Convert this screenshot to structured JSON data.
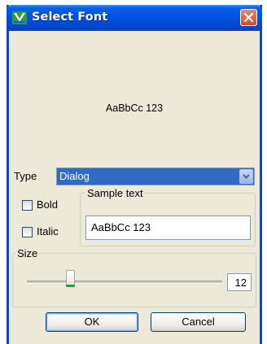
{
  "window": {
    "title": "Select Font"
  },
  "preview": {
    "text": "AaBbCc 123"
  },
  "type": {
    "label": "Type",
    "value": "Dialog"
  },
  "style": {
    "bold_label": "Bold",
    "italic_label": "Italic"
  },
  "sample": {
    "legend": "Sample text",
    "value": "AaBbCc 123"
  },
  "size": {
    "legend": "Size",
    "value": "12"
  },
  "buttons": {
    "ok": "OK",
    "cancel": "Cancel"
  },
  "colors": {
    "titlebar": "#0054e3",
    "close": "#d24a27",
    "selection": "#316ac5",
    "dialog_bg": "#ece9d8"
  },
  "icons": {
    "app": "font-app-icon",
    "close": "close-icon",
    "dropdown": "chevron-down-icon"
  }
}
